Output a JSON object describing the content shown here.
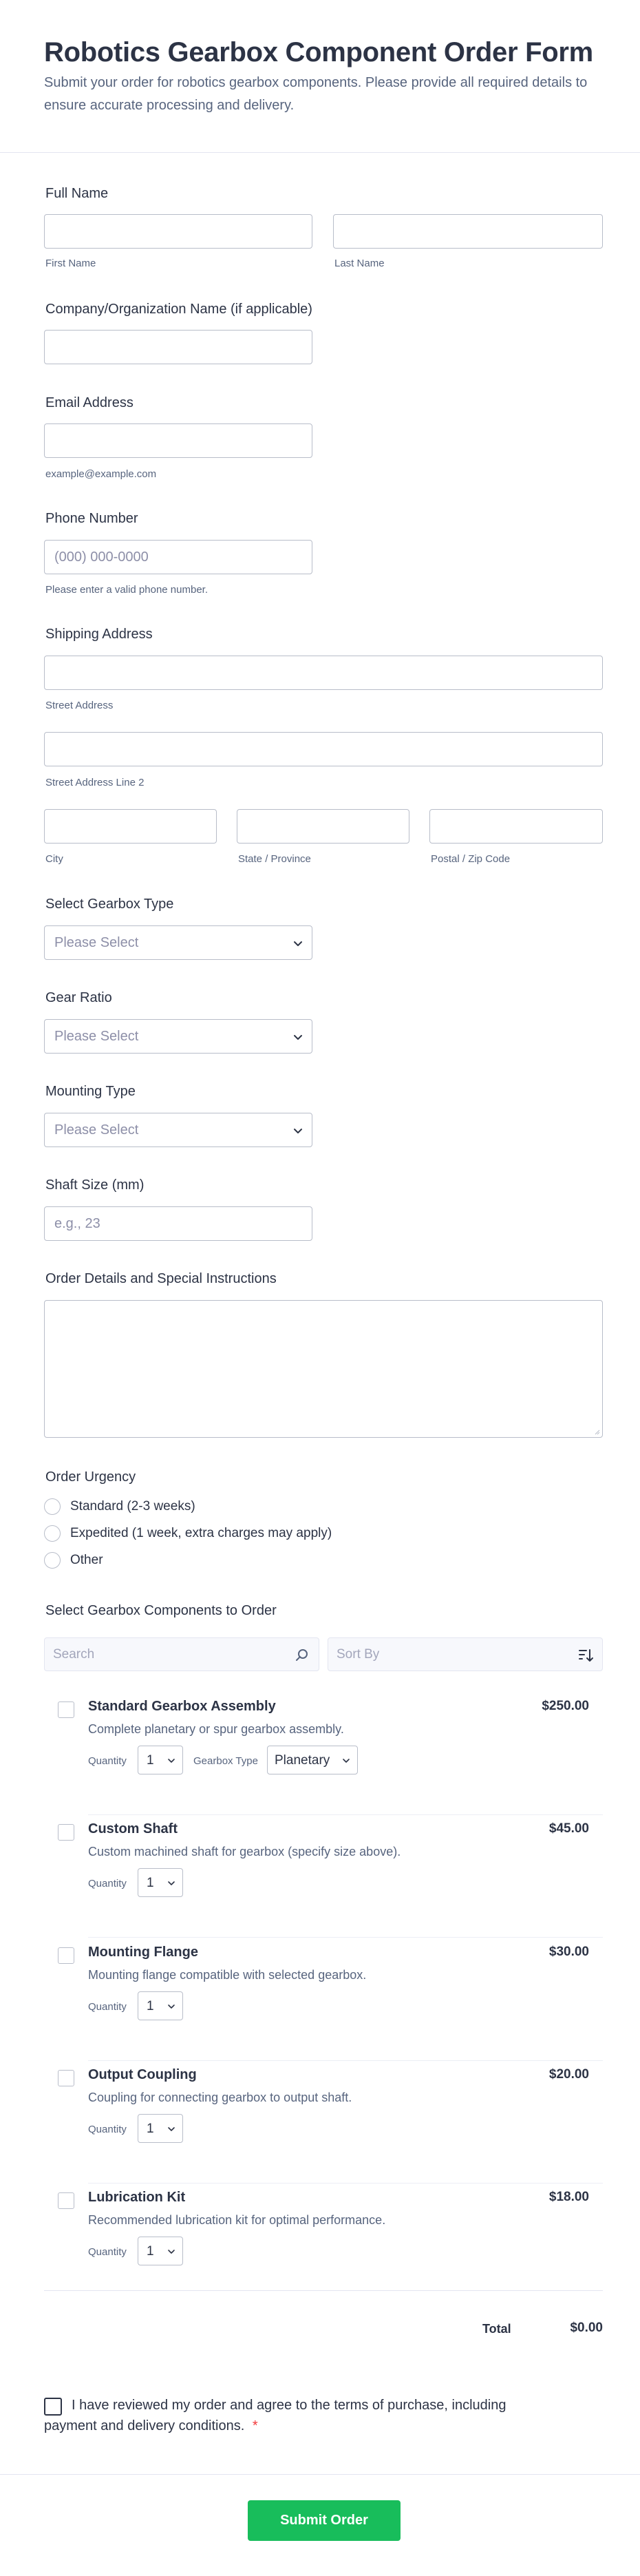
{
  "form": {
    "title": "Robotics Gearbox Component Order Form",
    "description": "Submit your order for robotics gearbox components. Please provide all required details to ensure accurate processing and delivery."
  },
  "full_name": {
    "label": "Full Name",
    "first_sub": "First Name",
    "last_sub": "Last Name"
  },
  "company": {
    "label": "Company/Organization Name (if applicable)"
  },
  "email": {
    "label": "Email Address",
    "sub": "example@example.com"
  },
  "phone": {
    "label": "Phone Number",
    "placeholder": "(000) 000-0000",
    "sub": "Please enter a valid phone number."
  },
  "address": {
    "label": "Shipping Address",
    "street_sub": "Street Address",
    "street2_sub": "Street Address Line 2",
    "city_sub": "City",
    "state_sub": "State / Province",
    "zip_sub": "Postal / Zip Code"
  },
  "gearbox_type": {
    "label": "Select Gearbox Type",
    "placeholder": "Please Select"
  },
  "gear_ratio": {
    "label": "Gear Ratio",
    "placeholder": "Please Select"
  },
  "mounting": {
    "label": "Mounting Type",
    "placeholder": "Please Select"
  },
  "shaft": {
    "label": "Shaft Size (mm)",
    "placeholder": "e.g., 23"
  },
  "details": {
    "label": "Order Details and Special Instructions"
  },
  "urgency": {
    "label": "Order Urgency",
    "options": [
      "Standard (2-3 weeks)",
      "Expedited (1 week, extra charges may apply)",
      "Other"
    ]
  },
  "components": {
    "label": "Select Gearbox Components to Order",
    "search_placeholder": "Search",
    "sort_placeholder": "Sort By",
    "quantity_label": "Quantity",
    "gearbox_type_label": "Gearbox Type",
    "items": [
      {
        "name": "Standard Gearbox Assembly",
        "price": "$250.00",
        "description": "Complete planetary or spur gearbox assembly.",
        "quantity": "1",
        "gearbox_type": "Planetary"
      },
      {
        "name": "Custom Shaft",
        "price": "$45.00",
        "description": "Custom machined shaft for gearbox (specify size above).",
        "quantity": "1"
      },
      {
        "name": "Mounting Flange",
        "price": "$30.00",
        "description": "Mounting flange compatible with selected gearbox.",
        "quantity": "1"
      },
      {
        "name": "Output Coupling",
        "price": "$20.00",
        "description": "Coupling for connecting gearbox to output shaft.",
        "quantity": "1"
      },
      {
        "name": "Lubrication Kit",
        "price": "$18.00",
        "description": "Recommended lubrication kit for optimal performance.",
        "quantity": "1"
      }
    ],
    "total_label": "Total",
    "total_value": "$0.00"
  },
  "agreement": {
    "line1": "I have reviewed my order and agree to the terms of purchase, including",
    "line2": "payment and delivery conditions.",
    "required_mark": "*"
  },
  "submit_label": "Submit Order",
  "colors": {
    "accent": "#18bd5b",
    "required": "#f23a3c",
    "text": "#2c3345",
    "muted": "#57647e",
    "border": "#b8bdc9"
  }
}
